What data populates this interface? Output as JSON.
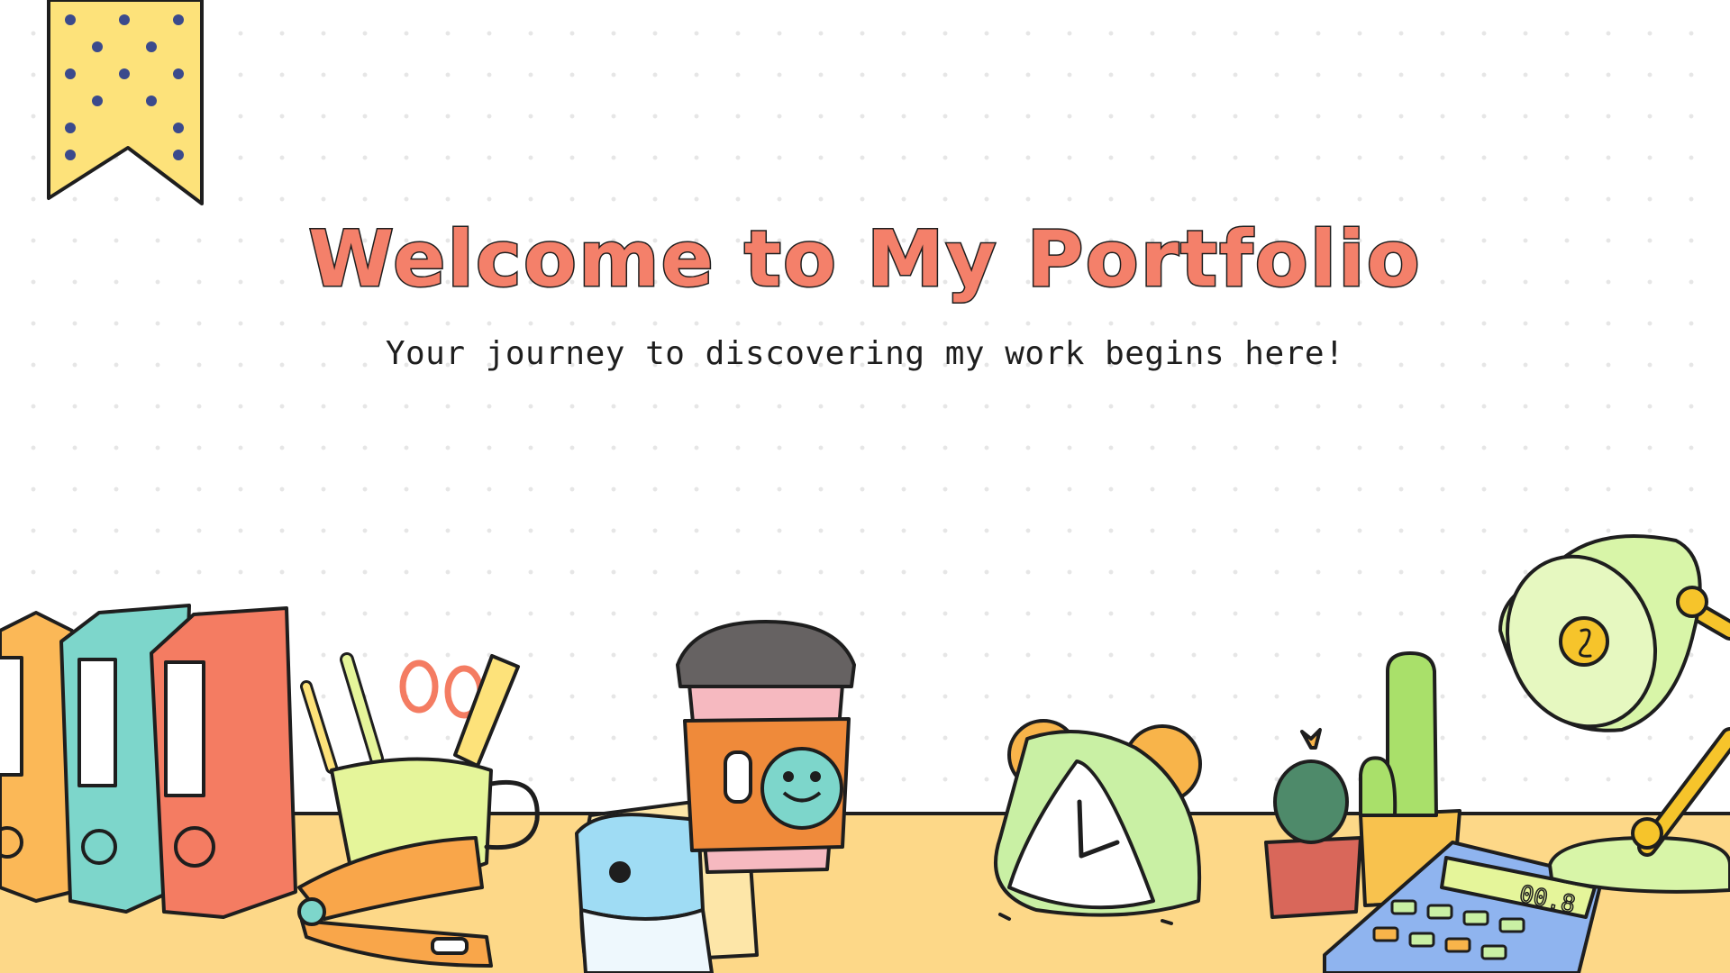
{
  "slide": {
    "title": "Welcome to My Portfolio",
    "subtitle": "Your journey to discovering my work begins here!"
  },
  "calculator_display": "00.8",
  "colors": {
    "title_fill": "#f4806a",
    "outline": "#1e1e1e",
    "desk": "#fdd888",
    "ribbon": "#fde27a",
    "ribbon_dots": "#3b4a8c",
    "binder_orange": "#fbb857",
    "binder_teal": "#7dd6cb",
    "binder_red": "#f47c62",
    "mug": "#e5f59a",
    "coffee_cup": "#f6b9c0",
    "coffee_lid": "#666262",
    "coffee_sleeve": "#ef8a3a",
    "clock": "#c9f0a4",
    "clock_bells": "#f8b44a",
    "lamp": "#d8f5a8",
    "lamp_arm": "#f6c42b",
    "calculator": "#8fb4ef",
    "cactus": "#a9e06a",
    "pot": "#d9675a"
  },
  "icons": [
    "bookmark-ribbon-icon",
    "binders-icon",
    "pen-holder-mug-icon",
    "stapler-icon",
    "pencil-sharpener-icon",
    "coffee-cup-icon",
    "alarm-clock-icon",
    "cactus-icon",
    "calculator-icon",
    "desk-lamp-icon"
  ]
}
